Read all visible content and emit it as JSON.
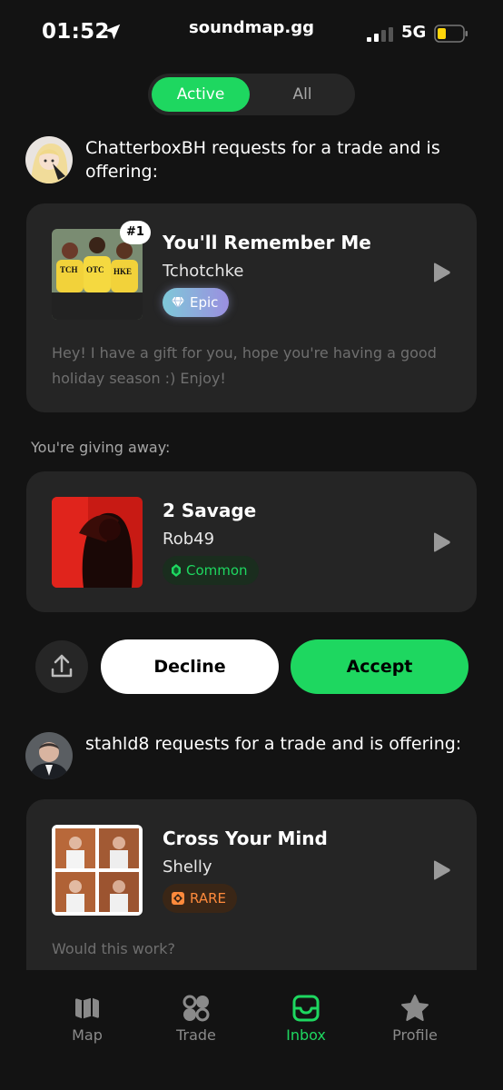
{
  "status_bar": {
    "time": "01:52",
    "site": "soundmap.gg",
    "network": "5G"
  },
  "segment": {
    "active_label": "Active",
    "all_label": "All"
  },
  "trades": [
    {
      "requester_text": "ChatterboxBH requests for a trade and is offering:",
      "offer": {
        "rank": "#1",
        "title": "You'll Remember Me",
        "artist": "Tchotchke",
        "rarity": "Epic",
        "message": "Hey! I have a gift for you, hope you're having a good holiday season :) Enjoy!"
      },
      "giving_label": "You're giving away:",
      "giving": {
        "title": "2 Savage",
        "artist": "Rob49",
        "rarity": "Common"
      },
      "actions": {
        "decline": "Decline",
        "accept": "Accept"
      }
    },
    {
      "requester_text": "stahld8 requests for a trade and is offering:",
      "offer": {
        "title": "Cross Your Mind",
        "artist": "Shelly",
        "rarity": "RARE",
        "message": "Would this work?"
      }
    }
  ],
  "tabs": [
    {
      "label": "Map",
      "icon": "map-icon"
    },
    {
      "label": "Trade",
      "icon": "trade-icon"
    },
    {
      "label": "Inbox",
      "icon": "inbox-icon",
      "active": true
    },
    {
      "label": "Profile",
      "icon": "star-icon"
    }
  ],
  "colors": {
    "accent": "#1ed760",
    "background": "#131313",
    "card": "#252525",
    "rare": "#ff8a3c"
  }
}
